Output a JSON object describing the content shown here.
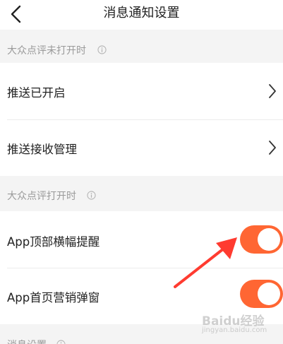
{
  "header": {
    "title": "消息通知设置"
  },
  "section_closed": {
    "label": "大众点评未打开时",
    "rows": [
      {
        "label": "推送已开启"
      },
      {
        "label": "推送接收管理"
      }
    ]
  },
  "section_open": {
    "label": "大众点评打开时",
    "rows": [
      {
        "label": "App顶部横幅提醒",
        "enabled": true
      },
      {
        "label": "App首页营销弹窗",
        "enabled": true
      }
    ]
  },
  "section_message": {
    "label": "消息设置"
  },
  "colors": {
    "accent": "#ff6633",
    "annotation_arrow": "#ff3b30"
  },
  "watermark": {
    "main": "Baidu经验",
    "sub": "jingyan.baidu.com"
  }
}
